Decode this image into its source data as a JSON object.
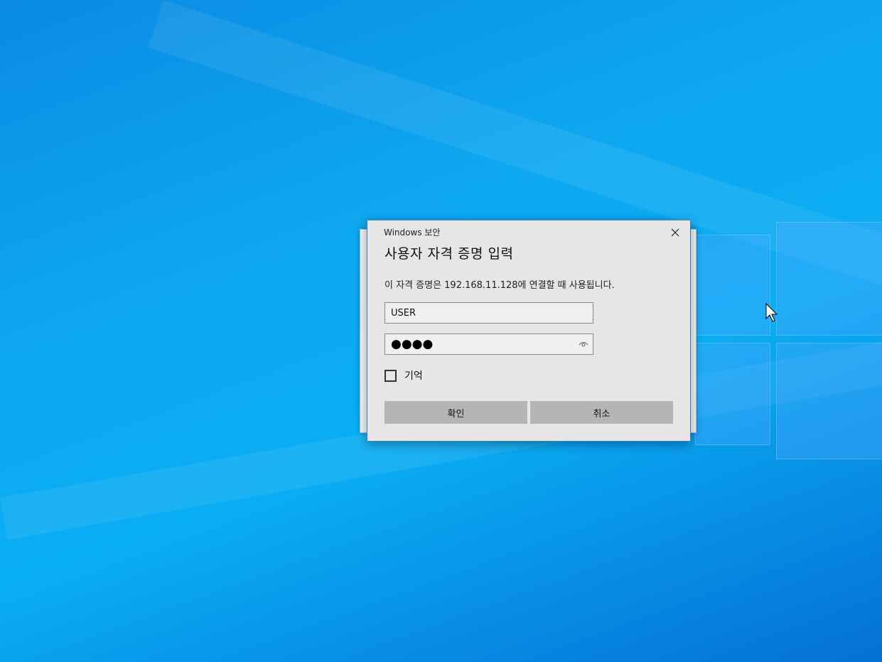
{
  "dialog": {
    "app_title": "Windows 보안",
    "heading": "사용자 자격 증명 입력",
    "description": "이 자격 증명은 192.168.11.128에 연결할 때 사용됩니다.",
    "username_value": "USER",
    "password_mask": "●●●●",
    "remember_label": "기억",
    "remember_checked": false,
    "ok_label": "확인",
    "cancel_label": "취소"
  },
  "icons": {
    "close": "close-icon",
    "reveal": "eye-icon",
    "cursor": "mouse-cursor-icon"
  },
  "colors": {
    "desktop_blue": "#0aaef4",
    "dialog_bg": "#e6e6e6",
    "button_bg": "#b5b5b5",
    "dialog_border": "#3d7fc0"
  }
}
